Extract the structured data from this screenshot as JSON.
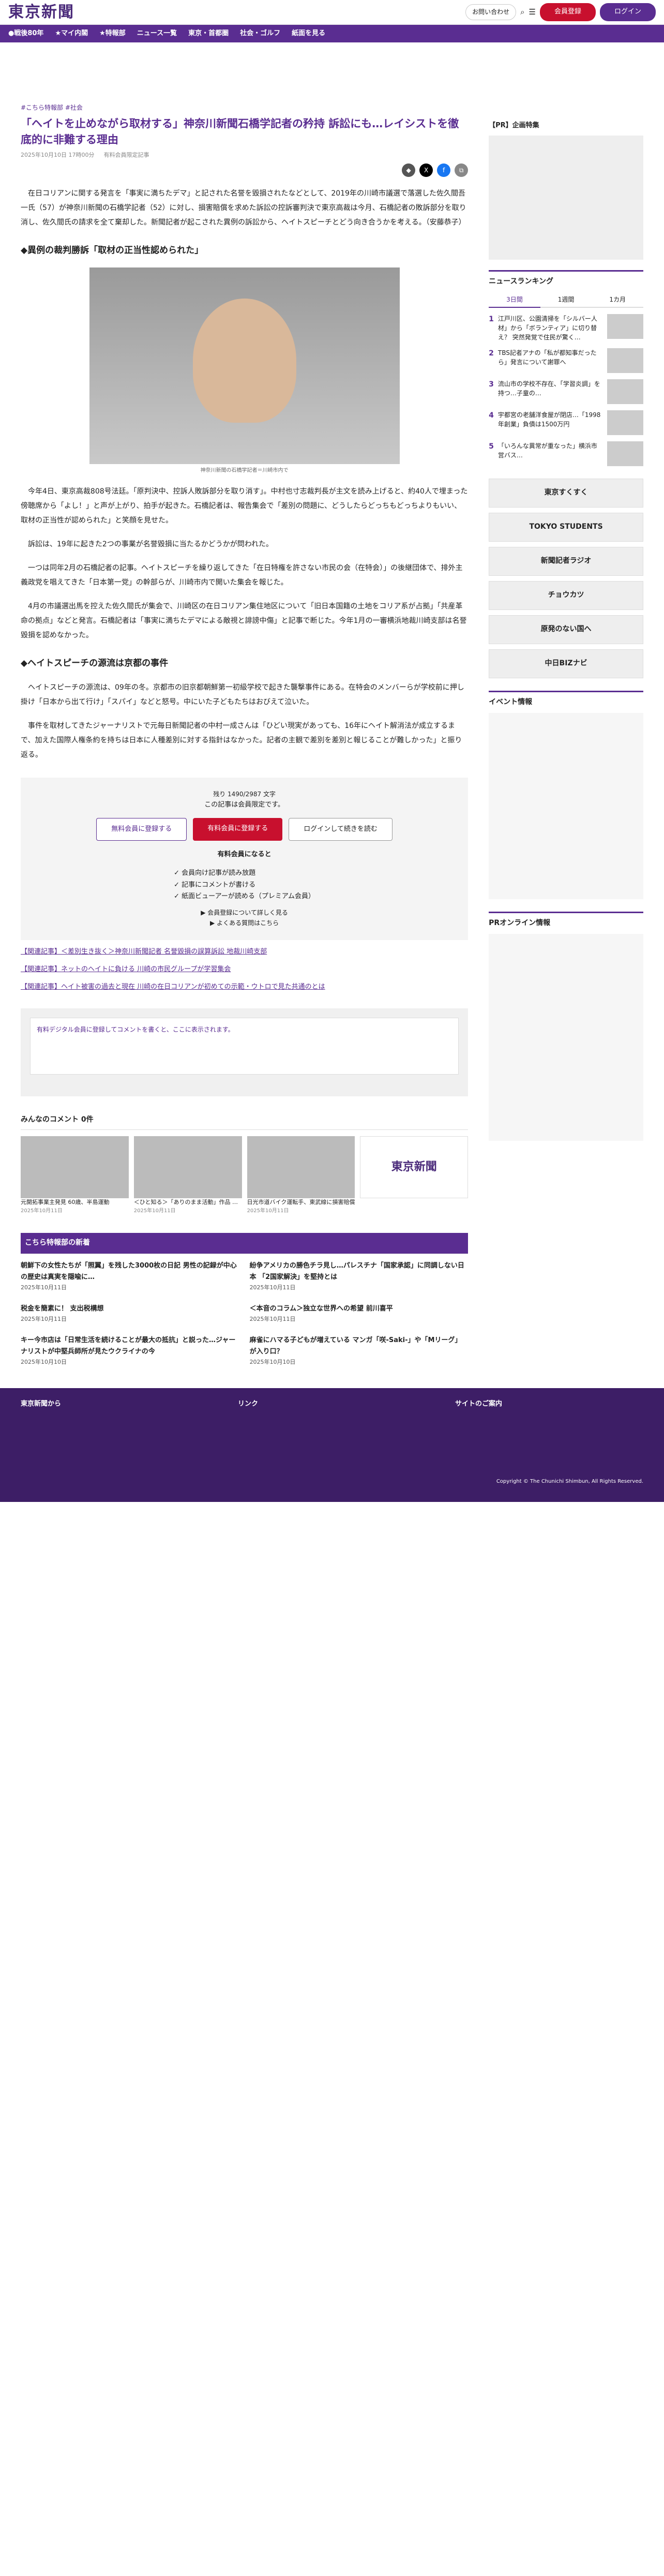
{
  "header": {
    "logo": "東京新聞",
    "pill": "お問い合わせ",
    "register": "会員登録",
    "login": "ログイン"
  },
  "nav": [
    "●戦後80年",
    "★マイ内閣",
    "★特報部",
    "ニュース一覧",
    "東京・首都圏",
    "社会・ゴルフ",
    "紙面を見る"
  ],
  "article": {
    "crumb": "#こちら特報部 #社会",
    "title": "「ヘイトを止めながら取材する」神奈川新聞石橋学記者の矜持 訴訟にも…レイシストを徹底的に非難する理由",
    "date": "2025年10月10日 17時00分",
    "member": "有料会員限定記事",
    "lead": "在日コリアンに関する発言を「事実に満ちたデマ」と記された名誉を毀損されたなどとして、2019年の川崎市議選で落選した佐久間吾一氏（57）が神奈川新聞の石橋学記者（52）に対し、損害賠償を求めた訴訟の控訴審判決で東京高裁は今月、石橋記者の敗訴部分を取り消し、佐久間氏の請求を全て棄却した。新聞記者が起こされた異例の訴訟から、ヘイトスピーチとどう向き合うかを考える。（安藤恭子）",
    "h2a": "◆異例の裁判勝訴「取材の正当性認められた」",
    "caption": "神奈川新聞の石橋学記者＝川崎市内で",
    "p1": "今年4日、東京高裁808号法廷。「原判決中、控訴人敗訴部分を取り消す」。中村也寸志裁判長が主文を読み上げると、約40人で埋まった傍聴席から「よし！」と声が上がり、拍手が起きた。石橋記者は、報告集会で「差別の問題に、どうしたらどっちもどっちよりもいい、取材の正当性が認められた」と笑顔を見せた。",
    "p2": "訴訟は、19年に起きた2つの事業が名誉毀損に当たるかどうかが問われた。",
    "p3": "一つは同年2月の石橋記者の記事。ヘイトスピーチを繰り返してきた「在日特権を許さない市民の会（在特会）」の後継団体で、排外主義政党を唱えてきた「日本第一党」の幹部らが、川崎市内で開いた集会を報じた。",
    "p4": "4月の市議選出馬を控えた佐久間氏が集会で、川崎区の在日コリアン集住地区について「旧日本国籍の土地をコリア系が占拠」「共産革命の拠点」などと発言。石橋記者は「事実に満ちたデマによる敵視と誹謗中傷」と記事で断じた。今年1月の一審横浜地裁川崎支部は名誉毀損を認めなかった。",
    "h2b": "◆ヘイトスピーチの源流は京都の事件",
    "p5": "ヘイトスピーチの源流は、09年の冬。京都市の旧京都朝鮮第一初級学校で起きた襲撃事件にある。在特会のメンバーらが学校前に押し掛け「日本から出て行け」「スパイ」などと怒号。中にいた子どもたちはおびえて泣いた。",
    "p6": "事件を取材してきたジャーナリストで元毎日新聞記者の中村一成さんは「ひどい現実があっても、16年にヘイト解消法が成立するまで、加えた国際人権条約を持ちは日本に人種差別に対する指針はなかった。記者の主観で差別を差別と報じることが難しかった」と振り返る。",
    "paywall": {
      "chars": "残り 1490/2987 文字",
      "limit": "この記事は会員限定です。",
      "free": "無料会員に登録する",
      "paid": "有料会員に登録する",
      "login": "ログインして続きを読む",
      "perk_title": "有料会員になると",
      "perks": [
        "✓ 会員向け記事が読み放題",
        "✓ 記事にコメントが書ける",
        "✓ 紙面ビューアーが読める（プレミアム会員）"
      ],
      "link1": "▶ 会員登録について詳しく見る",
      "link2": "▶ よくある質問はこちら"
    },
    "related": [
      "【関連記事】＜差別生き抜く＞神奈川新聞記者 名誉毀損の誤算訴訟 地裁川崎支部",
      "【関連記事】ネットのヘイトに負ける 川崎の市民グループが学習集会",
      "【関連記事】ヘイト被害の過去と現在 川崎の在日コリアンが初めての示範・ウトロで見た共通のとは"
    ]
  },
  "comments": {
    "title": "みんなのコメント",
    "count": "0件",
    "placeholder": "有料デジタル会員に登録してコメントを書くと、ここに表示されます。"
  },
  "related_grid": [
    {
      "t": "元開拓事業主発見 60歳、半島運動",
      "d": "2025年10月11日"
    },
    {
      "t": "＜ひと知る＞「ありのまま活動」作品 …",
      "d": "2025年10月11日"
    },
    {
      "t": "日光市道バイク運転手、東武線に損害賠償",
      "d": "2025年10月11日"
    },
    {
      "t": "東京新聞",
      "d": ""
    }
  ],
  "special": {
    "title": "こちら特報部の新着",
    "items": [
      {
        "h": "朝鮮下の女性たちが「照翼」を残した3000枚の日記 男性の記録が中心の歴史は真実を隠喩に…",
        "s": "2025年10月11日"
      },
      {
        "h": "紛争アメリカの勝色チラ見し…パレスチナ「国家承認」に同調しない日本 「2国家解決」を堅持とは",
        "s": "2025年10月11日"
      },
      {
        "h": "税金を簡素に！ 支出税構想",
        "s": "2025年10月11日"
      },
      {
        "h": "＜本音のコラム＞独立な世界への希望 前川喜平",
        "s": "2025年10月11日"
      },
      {
        "h": "キー今市店は「日常生活を続けることが最大の抵抗」と説った…ジャーナリストが中堅兵師所が見たウクライナの今",
        "s": "2025年10月10日"
      },
      {
        "h": "麻雀にハマる子どもが増えている マンガ「咲-Saki-」や「Mリーグ」が入り口？",
        "s": "2025年10月10日"
      }
    ]
  },
  "sidebar": {
    "ad": "【PR】企画特集",
    "ranking_title": "ニュースランキング",
    "tabs": [
      "3日間",
      "1週間",
      "1カ月"
    ],
    "ranks": [
      "江戸川区、公園清掃を「シルバー人材」から「ボランティア」に切り替え？ 突然発覚で住民が驚く…",
      "TBS記者アナの「私が都知事だったら」発言について謝罪へ",
      "流山市の学校不存在、「学習炎調」を持つ…子童の…",
      "宇都宮の老舗洋食屋が閉店…「1998年創業」負債は1500万円",
      "「いろんな異常が重なった」横浜市営バス…"
    ],
    "banners": [
      "東京すくすく",
      "TOKYO STUDENTS",
      "新聞記者ラジオ",
      "チョウカツ",
      "原発のない国へ",
      "中日BIZナビ"
    ],
    "event_title": "イベント情報",
    "pr_title": "PRオンライン情報"
  },
  "footer": {
    "c1": "東京新聞から",
    "c2": "リンク",
    "c3": "サイトのご案内",
    "copy": "Copyright © The Chunichi Shimbun, All Rights Reserved."
  }
}
